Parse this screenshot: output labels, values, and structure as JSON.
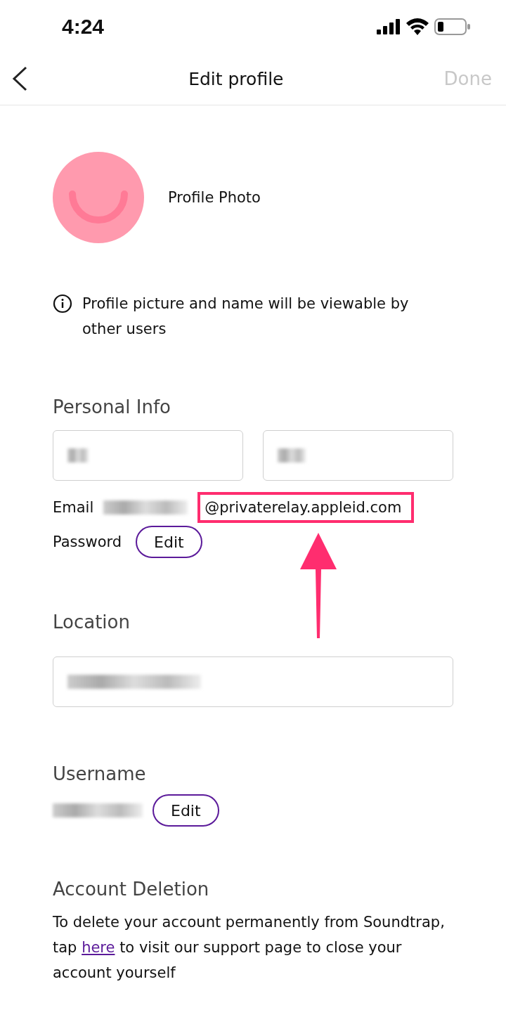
{
  "status_bar": {
    "time": "4:24"
  },
  "nav": {
    "title": "Edit profile",
    "done": {
      "label": "Done",
      "disabled": true
    }
  },
  "profile_photo": {
    "label": "Profile Photo"
  },
  "notice": "Profile picture and name will be viewable by other users",
  "personal_info": {
    "heading": "Personal Info",
    "name_fields": [
      {
        "redacted": true
      },
      {
        "redacted": true
      }
    ],
    "email": {
      "label": "Email",
      "redacted_prefix": true,
      "value": "@privaterelay.appleid.com",
      "highlighted": true
    },
    "password": {
      "label": "Password",
      "button": "Edit"
    }
  },
  "location": {
    "heading": "Location",
    "field": {
      "redacted": true
    }
  },
  "username": {
    "heading": "Username",
    "redacted": true,
    "button": "Edit"
  },
  "account_deletion": {
    "heading": "Account Deletion",
    "text_before": "To delete your account permanently from Soundtrap, tap",
    "link": "here",
    "text_after": "to visit our support page to close your account yourself"
  }
}
